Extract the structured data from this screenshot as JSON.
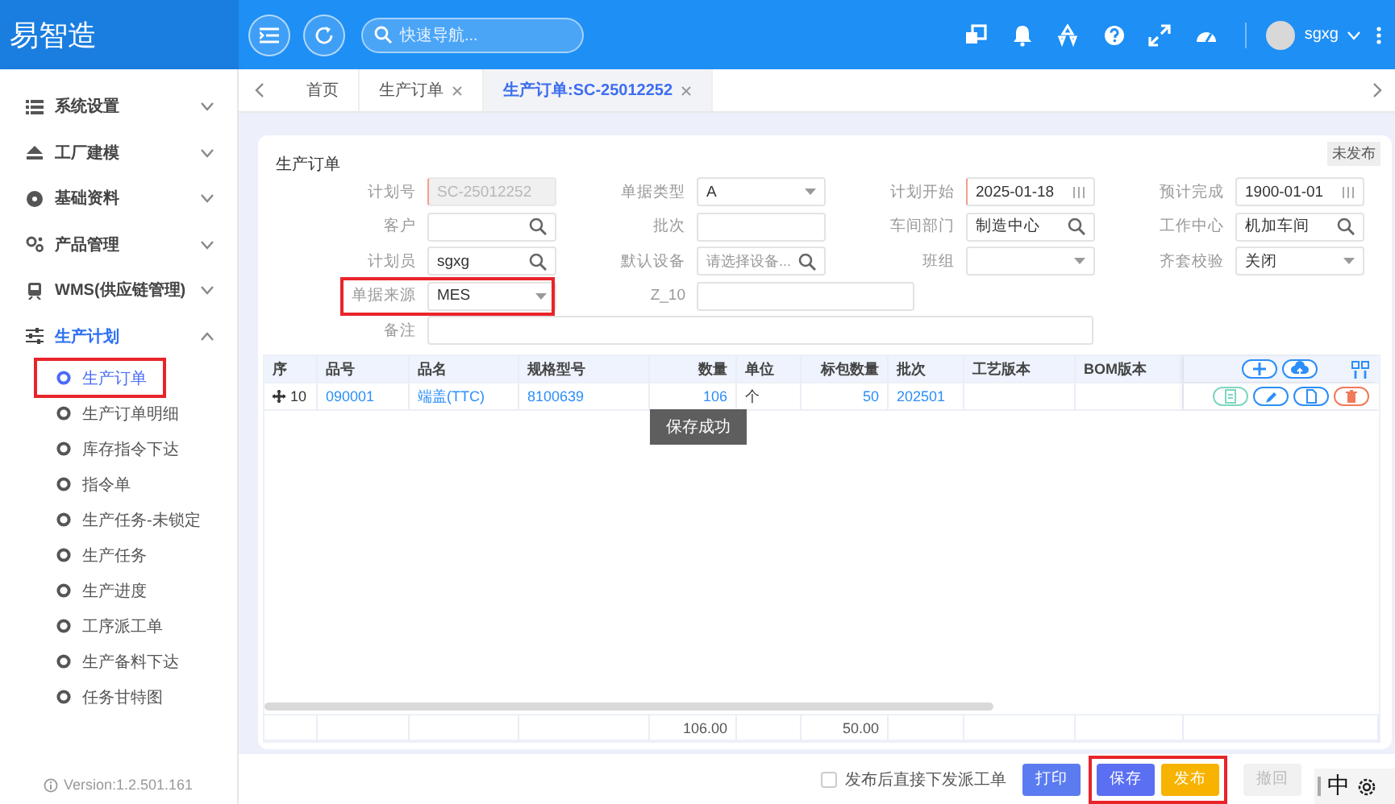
{
  "header": {
    "logo": "易智造",
    "search": {
      "placeholder": "快速导航..."
    },
    "user": "sgxg"
  },
  "sidebar": {
    "items": [
      {
        "label": "系统设置",
        "expanded": false
      },
      {
        "label": "工厂建模",
        "expanded": false
      },
      {
        "label": "基础资料",
        "expanded": false
      },
      {
        "label": "产品管理",
        "expanded": false
      },
      {
        "label": "WMS(供应链管理)",
        "expanded": false
      },
      {
        "label": "生产计划",
        "expanded": true,
        "children": [
          {
            "label": "生产订单",
            "selected": true,
            "highlighted": true
          },
          {
            "label": "生产订单明细",
            "selected": false,
            "highlighted": false
          },
          {
            "label": "库存指令下达",
            "selected": false,
            "highlighted": false
          },
          {
            "label": "指令单",
            "selected": false,
            "highlighted": false
          },
          {
            "label": "生产任务-未锁定",
            "selected": false,
            "highlighted": false
          },
          {
            "label": "生产任务",
            "selected": false,
            "highlighted": false
          },
          {
            "label": "生产进度",
            "selected": false,
            "highlighted": false
          },
          {
            "label": "工序派工单",
            "selected": false,
            "highlighted": false
          },
          {
            "label": "生产备料下达",
            "selected": false,
            "highlighted": false
          },
          {
            "label": "任务甘特图",
            "selected": false,
            "highlighted": false
          }
        ]
      }
    ],
    "version": "Version:1.2.501.161"
  },
  "tabs": [
    {
      "label": "首页",
      "closable": false,
      "selected": false
    },
    {
      "label": "生产订单",
      "closable": true,
      "selected": false
    },
    {
      "label": "生产订单:SC-25012252",
      "closable": true,
      "selected": true
    }
  ],
  "form": {
    "title": "生产订单",
    "status": "未发布",
    "fields": [
      {
        "label": "计划号",
        "kind": "text",
        "value": "SC-25012252",
        "disabled": true,
        "required": true,
        "highlighted": false
      },
      {
        "label": "单据类型",
        "kind": "select",
        "value": "A",
        "disabled": false,
        "required": false,
        "highlighted": false
      },
      {
        "label": "计划开始",
        "kind": "date",
        "value": "2025-01-18",
        "disabled": false,
        "required": true,
        "highlighted": false
      },
      {
        "label": "预计完成",
        "kind": "date",
        "value": "1900-01-01",
        "disabled": false,
        "required": false,
        "highlighted": false
      },
      {
        "label": "客户",
        "kind": "search",
        "disabled": false,
        "required": false,
        "highlighted": false
      },
      {
        "label": "批次",
        "kind": "text",
        "disabled": false,
        "required": false,
        "highlighted": false
      },
      {
        "label": "车间部门",
        "kind": "search",
        "value": "制造中心",
        "disabled": false,
        "required": false,
        "highlighted": false
      },
      {
        "label": "工作中心",
        "kind": "search",
        "value": "机加车间",
        "disabled": false,
        "required": false,
        "highlighted": false
      },
      {
        "label": "计划员",
        "kind": "search",
        "value": "sgxg",
        "disabled": false,
        "required": false,
        "highlighted": false
      },
      {
        "label": "默认设备",
        "kind": "search",
        "placeholder": "请选择设备...",
        "disabled": false,
        "required": false,
        "highlighted": false
      },
      {
        "label": "班组",
        "kind": "select",
        "disabled": false,
        "required": false,
        "highlighted": false
      },
      {
        "label": "齐套校验",
        "kind": "select",
        "value": "关闭",
        "disabled": false,
        "required": false,
        "highlighted": false
      },
      {
        "label": "单据来源",
        "kind": "select",
        "value": "MES",
        "disabled": false,
        "required": false,
        "highlighted": true
      },
      {
        "label": "Z_10",
        "kind": "wide",
        "disabled": false,
        "required": false,
        "highlighted": false
      },
      {
        "label": "备注",
        "kind": "note",
        "disabled": false,
        "required": false,
        "highlighted": false
      }
    ]
  },
  "table": {
    "columns": [
      {
        "label": "序",
        "kind": "text"
      },
      {
        "label": "品号",
        "kind": "text"
      },
      {
        "label": "品名",
        "kind": "text"
      },
      {
        "label": "规格型号",
        "kind": "text"
      },
      {
        "label": "数量",
        "kind": "number",
        "total": "106.00"
      },
      {
        "label": "单位",
        "kind": "text"
      },
      {
        "label": "标包数量",
        "kind": "number",
        "total": "50.00"
      },
      {
        "label": "批次",
        "kind": "text"
      },
      {
        "label": "工艺版本",
        "kind": "text"
      },
      {
        "label": "BOM版本",
        "kind": "text"
      }
    ],
    "header_actions": [
      {
        "kind": "add"
      },
      {
        "kind": "upload"
      }
    ],
    "rows": [
      {
        "cells": [
          {
            "text": "10",
            "link": false
          },
          {
            "text": "090001",
            "link": true
          },
          {
            "text": "端盖(TTC)",
            "link": true
          },
          {
            "text": "8100639",
            "link": true
          },
          {
            "text": "106",
            "link": true
          },
          {
            "text": "个",
            "link": false
          },
          {
            "text": "50",
            "link": true
          },
          {
            "text": "202501",
            "link": true
          }
        ],
        "actions": [
          {
            "kind": "doc"
          },
          {
            "kind": "edit"
          },
          {
            "kind": "file"
          },
          {
            "kind": "delete"
          }
        ]
      }
    ]
  },
  "toast": {
    "text": "保存成功"
  },
  "footer": {
    "checkbox": {
      "label": "发布后直接下发派工单",
      "checked": false
    },
    "buttons": [
      {
        "label": "打印",
        "kind": "print",
        "highlighted": false
      },
      {
        "label": "保存",
        "kind": "save",
        "highlighted": true
      },
      {
        "label": "发布",
        "kind": "publish",
        "highlighted": true
      },
      {
        "label": "撤回",
        "kind": "disabled",
        "highlighted": false
      }
    ]
  },
  "ime": {
    "text": "中"
  }
}
